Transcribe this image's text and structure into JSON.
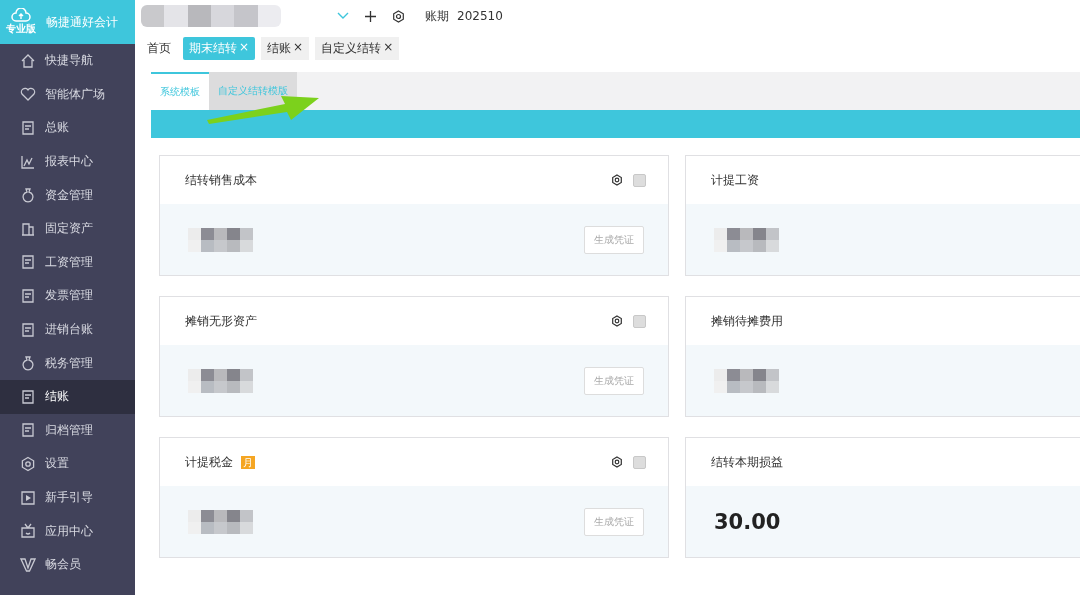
{
  "sidebar": {
    "logo": {
      "name": "畅捷通好会计",
      "edition": "专业版"
    },
    "items": [
      {
        "label": "快捷导航",
        "selected": false
      },
      {
        "label": "智能体广场",
        "selected": false
      },
      {
        "label": "总账",
        "selected": false
      },
      {
        "label": "报表中心",
        "selected": false
      },
      {
        "label": "资金管理",
        "selected": false
      },
      {
        "label": "固定资产",
        "selected": false
      },
      {
        "label": "工资管理",
        "selected": false
      },
      {
        "label": "发票管理",
        "selected": false
      },
      {
        "label": "进销台账",
        "selected": false
      },
      {
        "label": "税务管理",
        "selected": false
      },
      {
        "label": "结账",
        "selected": true
      },
      {
        "label": "归档管理",
        "selected": false
      },
      {
        "label": "设置",
        "selected": false
      },
      {
        "label": "新手引导",
        "selected": false
      },
      {
        "label": "应用中心",
        "selected": false
      },
      {
        "label": "畅会员",
        "selected": false
      }
    ]
  },
  "topbar": {
    "period_label": "账期",
    "period": "202510"
  },
  "tabs": [
    {
      "label": "首页",
      "closable": false,
      "selected": false
    },
    {
      "label": "期末结转",
      "closable": true,
      "selected": true
    },
    {
      "label": "结账",
      "closable": true,
      "selected": false
    },
    {
      "label": "自定义结转",
      "closable": true,
      "selected": false
    }
  ],
  "close_glyph": "×",
  "subtabs": [
    {
      "label": "系统模板",
      "selected": true
    },
    {
      "label": "自定义结转模版",
      "selected": false
    }
  ],
  "cards": [
    {
      "title": "结转销售成本",
      "actions": true,
      "checked": false,
      "button": "生成凭证"
    },
    {
      "title": "计提工资",
      "actions": false
    },
    {
      "title": "摊销无形资产",
      "actions": true,
      "checked": false,
      "button": "生成凭证"
    },
    {
      "title": "摊销待摊费用",
      "actions": false
    },
    {
      "title": "计提税金",
      "badge": "月",
      "actions": true,
      "checked": false,
      "button": "生成凭证"
    },
    {
      "title": "结转本期损益",
      "actions": false,
      "amount": "30.00"
    }
  ]
}
